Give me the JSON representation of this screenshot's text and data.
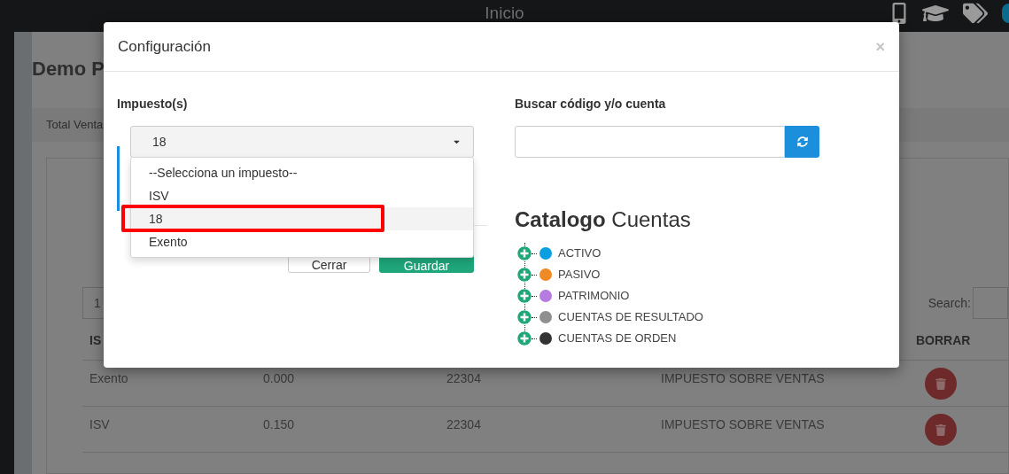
{
  "top_bar": {
    "title": "Inicio"
  },
  "page": {
    "title": "Demo P",
    "tabs": [
      {
        "label": "Total Venta",
        "selected": true
      }
    ],
    "page_size": "1",
    "search_label": "Search:",
    "table": {
      "columns": [
        "IS",
        "BORRAR"
      ],
      "rows": [
        {
          "cells": [
            "Exento",
            "0.000",
            "22304",
            "IMPUESTO SOBRE VENTAS"
          ]
        },
        {
          "cells": [
            "ISV",
            "0.150",
            "22304",
            "IMPUESTO SOBRE VENTAS"
          ]
        }
      ]
    }
  },
  "modal": {
    "title": "Configuración",
    "close": "×",
    "tax": {
      "label": "Impuesto(s)",
      "value": "18",
      "expanded": true,
      "options": [
        {
          "label": "--Selecciona un impuesto--",
          "selected": false,
          "annotated": false
        },
        {
          "label": "ISV",
          "selected": false,
          "annotated": false
        },
        {
          "label": "18",
          "selected": true,
          "annotated": true
        },
        {
          "label": "Exento",
          "selected": false,
          "annotated": false
        }
      ]
    },
    "buttons": [
      {
        "label": "Cerrar",
        "kind": "default"
      },
      {
        "label": "Guardar",
        "kind": "primary"
      }
    ],
    "search": {
      "label": "Buscar código y/o cuenta"
    },
    "catalog": {
      "title": "**Catalogo** Cuentas",
      "items": [
        {
          "label": "ACTIVO",
          "color": "#0b9ee0",
          "expanded": false
        },
        {
          "label": "PASIVO",
          "color": "#ef8a25",
          "expanded": false
        },
        {
          "label": "PATRIMONIO",
          "color": "#b57be0",
          "expanded": false
        },
        {
          "label": "CUENTAS DE RESULTADO",
          "color": "#8f8f8f",
          "expanded": false
        },
        {
          "label": "CUENTAS DE ORDEN",
          "color": "#333333",
          "expanded": false
        }
      ]
    }
  }
}
